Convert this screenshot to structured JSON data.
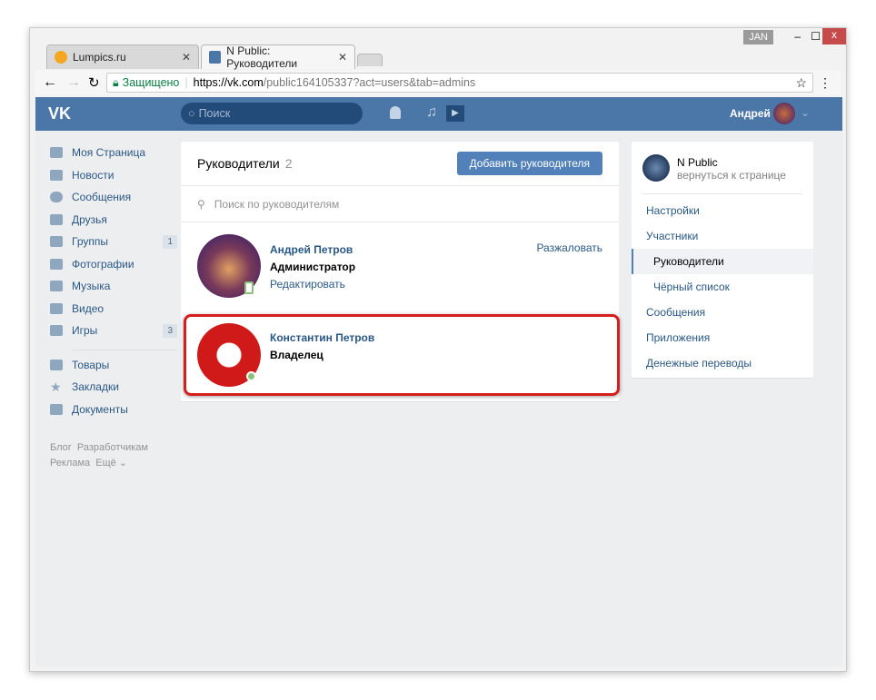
{
  "browser": {
    "user_badge": "JAN",
    "tabs": [
      {
        "label": "Lumpics.ru"
      },
      {
        "label": "N Public: Руководители"
      }
    ],
    "secure_label": "Защищено",
    "url_host": "https://vk.com",
    "url_path": "/public164105337?act=users&tab=admins"
  },
  "header": {
    "search_placeholder": "Поиск",
    "user_name": "Андрей"
  },
  "sidebar": {
    "items": [
      {
        "label": "Моя Страница"
      },
      {
        "label": "Новости"
      },
      {
        "label": "Сообщения"
      },
      {
        "label": "Друзья"
      },
      {
        "label": "Группы",
        "count": "1"
      },
      {
        "label": "Фотографии"
      },
      {
        "label": "Музыка"
      },
      {
        "label": "Видео"
      },
      {
        "label": "Игры",
        "count": "3"
      }
    ],
    "items2": [
      {
        "label": "Товары"
      },
      {
        "label": "Закладки"
      },
      {
        "label": "Документы"
      }
    ],
    "footer": [
      "Блог",
      "Разработчикам",
      "Реклама",
      "Ещё ⌄"
    ]
  },
  "main": {
    "title": "Руководители",
    "count": "2",
    "add_button": "Добавить руководителя",
    "search_placeholder": "Поиск по руководителям",
    "managers": [
      {
        "name": "Андрей Петров",
        "role": "Администратор",
        "edit": "Редактировать",
        "demote": "Разжаловать"
      },
      {
        "name": "Константин Петров",
        "role": "Владелец"
      }
    ]
  },
  "right": {
    "group_name": "N Public",
    "back": "вернуться к странице",
    "menu": [
      "Настройки",
      "Участники",
      "Руководители",
      "Чёрный список",
      "Сообщения",
      "Приложения",
      "Денежные переводы"
    ]
  }
}
